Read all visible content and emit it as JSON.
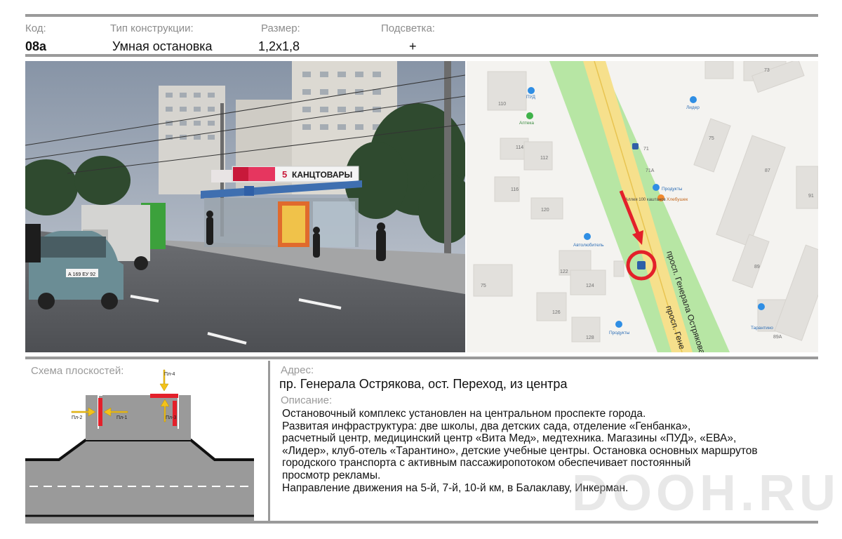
{
  "header": {
    "code_label": "Код:",
    "code_value": "08а",
    "type_label": "Тип конструкции:",
    "type_value": "Умная остановка",
    "size_label": "Размер:",
    "size_value": "1,2х1,8",
    "light_label": "Подсветка:",
    "light_value": "+"
  },
  "photo": {
    "kiosk_sign": "КАНЦТОВАРЫ",
    "kiosk_number": "5",
    "left_sign": "КАНЦТОВАРЫ",
    "plate": "А 169 ЕУ 92"
  },
  "map": {
    "street_1": "просп. Генерала Острякова",
    "street_2": "просп. Гене",
    "pois": {
      "pud": "ПУД",
      "apteka": "Аптека",
      "lider": "Лидер",
      "produkty": "Продукты",
      "khlebushek": "Хлебушек",
      "avtolyubitel": "Автолюбитель",
      "produkty2": "Продукты",
      "tarantino": "Тарантино",
      "stop": "Аллея 100 каштанов"
    },
    "houses": [
      "110",
      "114",
      "112",
      "116",
      "120",
      "122",
      "124",
      "126",
      "128",
      "73",
      "75",
      "87",
      "91",
      "89",
      "89А",
      "71",
      "71А",
      "75"
    ]
  },
  "scheme": {
    "title": "Схема плоскостей:",
    "p1": "Пл-1",
    "p2": "Пл-2",
    "p3": "Пл-3",
    "p4": "Пл-4"
  },
  "info": {
    "address_label": "Адрес:",
    "address": "пр. Генерала Острякова, ост. Переход, из центра",
    "description_label": "Описание:",
    "description_lines": [
      "Остановочный комплекс установлен на центральном проспекте города.",
      "Развитая инфраструктура: две школы, два детских сада, отделение «Генбанка»,",
      "расчетный центр, медицинский центр «Вита Мед», медтехника. Магазины «ПУД», «ЕВА»,",
      "«Лидер», клуб-отель «Тарантино», детские учебные центры. Остановка основных маршрутов",
      "городского транспорта с активным пассажиропотоком обеспечивает постоянный",
      "просмотр рекламы.",
      "Направление движения на 5-й, 7-й, 10-й км, в Балаклаву, Инкерман."
    ],
    "watermark": "DOOH.RU"
  },
  "colors": {
    "accent_red": "#e3202a",
    "arrow_yellow": "#f3c21a",
    "map_green": "#b7e6a4",
    "map_road": "#f6e08c",
    "bar_gray": "#9a9a9a"
  }
}
